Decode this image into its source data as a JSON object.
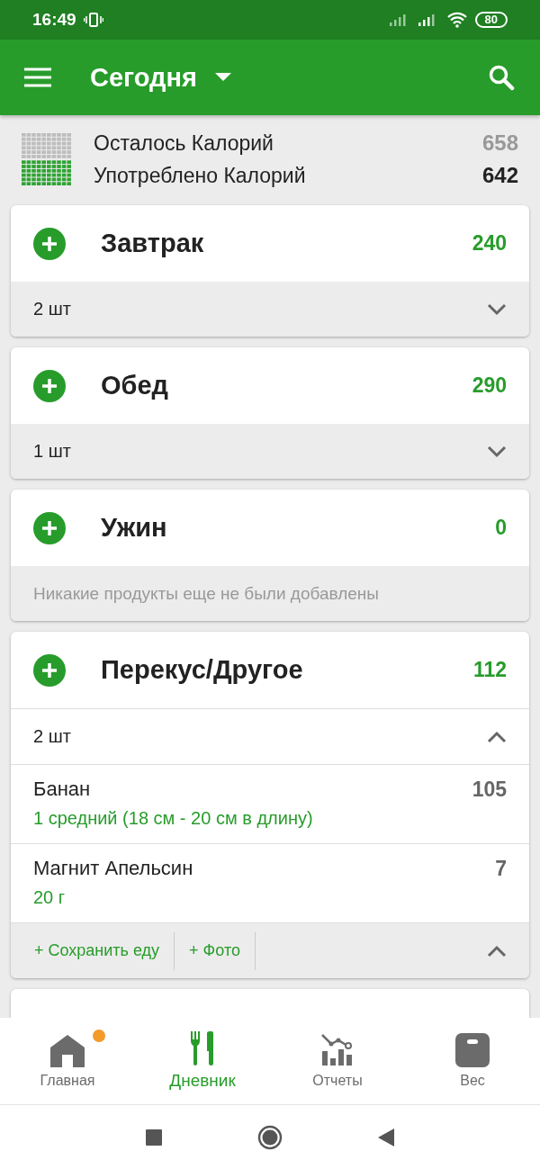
{
  "status_bar": {
    "time": "16:49",
    "battery": "80"
  },
  "app_bar": {
    "title": "Сегодня"
  },
  "summary": {
    "rows": [
      {
        "label": "Осталось Калорий",
        "value": "658",
        "kind": "remaining"
      },
      {
        "label": "Употреблено Калорий",
        "value": "642",
        "kind": "consumed"
      }
    ]
  },
  "meals": [
    {
      "name": "Завтрак",
      "calories": "240",
      "count": "2 шт",
      "expanded": false
    },
    {
      "name": "Обед",
      "calories": "290",
      "count": "1 шт",
      "expanded": false
    },
    {
      "name": "Ужин",
      "calories": "0",
      "empty_text": "Никакие продукты еще не были добавлены",
      "expanded": false
    },
    {
      "name": "Перекус/Другое",
      "calories": "112",
      "count": "2 шт",
      "expanded": true,
      "items": [
        {
          "name": "Банан",
          "portion": "1 средний (18 см - 20 см в длину)",
          "calories": "105"
        },
        {
          "name": "Магнит Апельсин",
          "portion": "20  г",
          "calories": "7"
        }
      ],
      "actions": [
        "+ Сохранить еду",
        "+ Фото"
      ]
    }
  ],
  "bottom_nav": [
    {
      "label": "Главная",
      "kind": "home",
      "selected": false,
      "badge": true
    },
    {
      "label": "Дневник",
      "kind": "diary",
      "selected": true,
      "badge": false
    },
    {
      "label": "Отчеты",
      "kind": "reports",
      "selected": false,
      "badge": false
    },
    {
      "label": "Вес",
      "kind": "weight",
      "selected": false,
      "badge": false
    }
  ]
}
